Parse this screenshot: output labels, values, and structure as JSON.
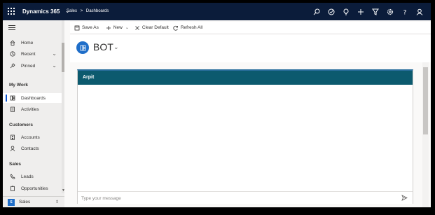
{
  "topbar": {
    "app_name": "Dynamics 365",
    "breadcrumb": [
      "Sales",
      ">",
      "Dashboards"
    ],
    "icons": [
      "search-icon",
      "task-icon",
      "lightbulb-icon",
      "plus-icon",
      "filter-icon",
      "settings-icon",
      "help-icon",
      "user-icon"
    ]
  },
  "sidebar": {
    "items": [
      {
        "label": "Home",
        "icon": "home-icon"
      },
      {
        "label": "Recent",
        "icon": "clock-icon"
      },
      {
        "label": "Pinned",
        "icon": "pin-icon"
      }
    ],
    "sections": [
      {
        "title": "My Work",
        "items": [
          {
            "label": "Dashboards",
            "icon": "dashboard-icon"
          },
          {
            "label": "Activities",
            "icon": "activities-icon"
          }
        ]
      },
      {
        "title": "Customers",
        "items": [
          {
            "label": "Accounts",
            "icon": "building-icon"
          },
          {
            "label": "Contacts",
            "icon": "person-icon"
          }
        ]
      },
      {
        "title": "Sales",
        "items": [
          {
            "label": "Leads",
            "icon": "phone-icon"
          },
          {
            "label": "Opportunities",
            "icon": "clipboard-icon"
          }
        ]
      }
    ],
    "area": {
      "badge": "S",
      "label": "Sales"
    }
  },
  "commandbar": {
    "save_as": "Save As",
    "new": "New",
    "clear_default": "Clear Default",
    "refresh_all": "Refresh All"
  },
  "dashboard": {
    "title": "BOT"
  },
  "panel": {
    "title": "Arpit",
    "message_placeholder": "Type your message"
  },
  "colors": {
    "topbar": "#0b1c3a",
    "panel_header": "#0c5a6e",
    "accent": "#1f6ec9"
  }
}
